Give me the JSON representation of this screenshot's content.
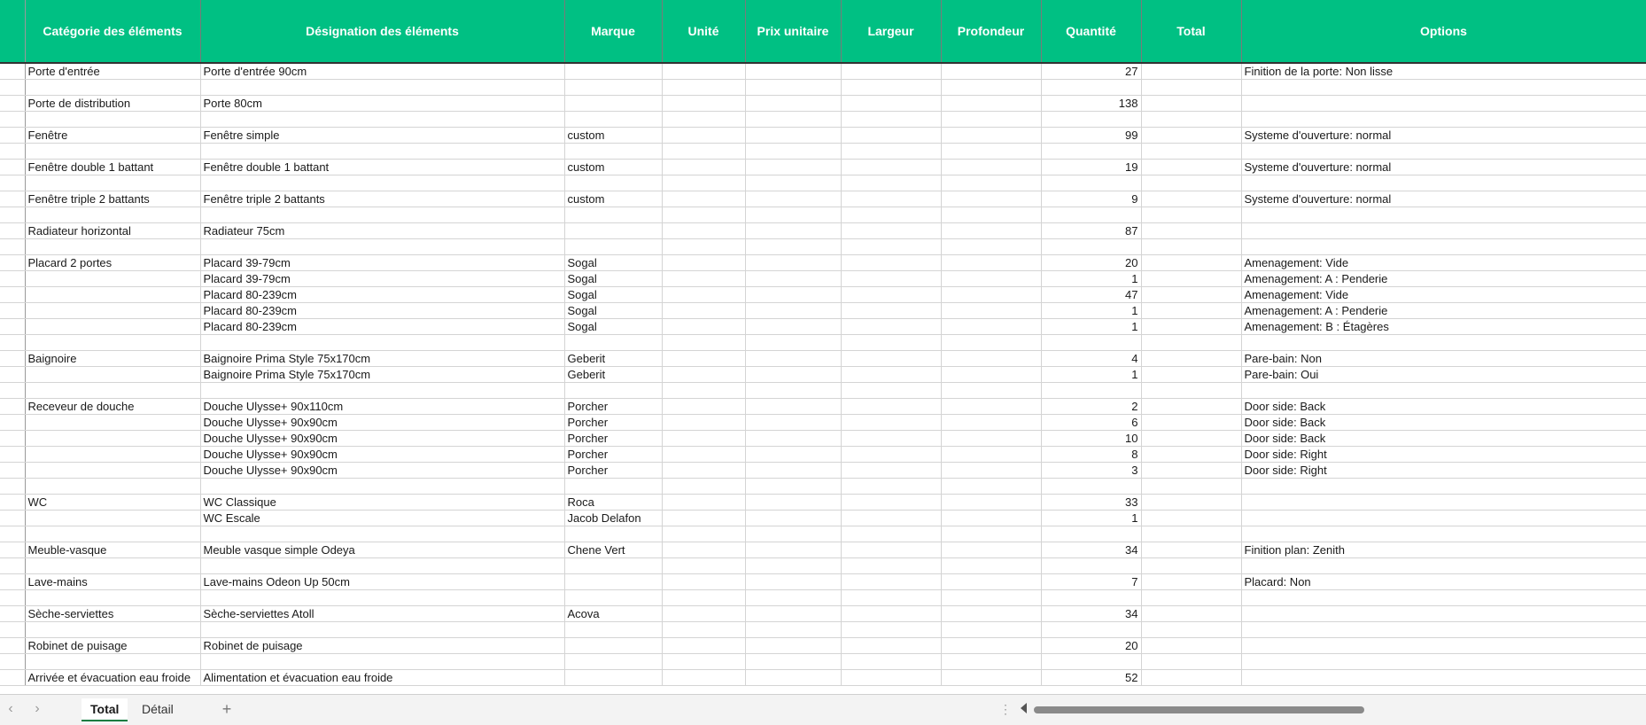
{
  "headers": [
    "Catégorie des éléments",
    "Désignation des éléments",
    "Marque",
    "Unité",
    "Prix unitaire",
    "Largeur",
    "Profondeur",
    "Quantité",
    "Total",
    "Options"
  ],
  "rows": [
    {
      "cat": "Porte d'entrée",
      "des": "Porte d'entrée 90cm",
      "marque": "",
      "qty": "27",
      "opt": "Finition de la porte: Non lisse"
    },
    {
      "spacer": true
    },
    {
      "cat": "Porte de distribution",
      "des": "Porte 80cm",
      "marque": "",
      "qty": "138",
      "opt": ""
    },
    {
      "spacer": true
    },
    {
      "cat": "Fenêtre",
      "des": "Fenêtre simple",
      "marque": "custom",
      "qty": "99",
      "opt": "Systeme d'ouverture: normal"
    },
    {
      "spacer": true
    },
    {
      "cat": "Fenêtre double 1 battant",
      "des": "Fenêtre double 1 battant",
      "marque": "custom",
      "qty": "19",
      "opt": "Systeme d'ouverture: normal"
    },
    {
      "spacer": true
    },
    {
      "cat": "Fenêtre triple 2 battants",
      "des": "Fenêtre triple 2 battants",
      "marque": "custom",
      "qty": "9",
      "opt": "Systeme d'ouverture: normal"
    },
    {
      "spacer": true
    },
    {
      "cat": "Radiateur horizontal",
      "des": "Radiateur 75cm",
      "marque": "",
      "qty": "87",
      "opt": ""
    },
    {
      "spacer": true
    },
    {
      "cat": "Placard 2 portes",
      "des": "Placard 39-79cm",
      "marque": "Sogal",
      "qty": "20",
      "opt": "Amenagement: Vide"
    },
    {
      "cat": "",
      "des": "Placard 39-79cm",
      "marque": "Sogal",
      "qty": "1",
      "opt": "Amenagement: A : Penderie"
    },
    {
      "cat": "",
      "des": "Placard 80-239cm",
      "marque": "Sogal",
      "qty": "47",
      "opt": "Amenagement: Vide"
    },
    {
      "cat": "",
      "des": "Placard 80-239cm",
      "marque": "Sogal",
      "qty": "1",
      "opt": "Amenagement: A : Penderie"
    },
    {
      "cat": "",
      "des": "Placard 80-239cm",
      "marque": "Sogal",
      "qty": "1",
      "opt": "Amenagement: B : Étagères"
    },
    {
      "spacer": true
    },
    {
      "cat": "Baignoire",
      "des": "Baignoire Prima Style 75x170cm",
      "marque": "Geberit",
      "qty": "4",
      "opt": "Pare-bain: Non"
    },
    {
      "cat": "",
      "des": "Baignoire Prima Style 75x170cm",
      "marque": "Geberit",
      "qty": "1",
      "opt": "Pare-bain: Oui"
    },
    {
      "spacer": true
    },
    {
      "cat": "Receveur de douche",
      "des": "Douche Ulysse+ 90x110cm",
      "marque": "Porcher",
      "qty": "2",
      "opt": "Door side: Back"
    },
    {
      "cat": "",
      "des": "Douche Ulysse+ 90x90cm",
      "marque": "Porcher",
      "qty": "6",
      "opt": "Door side: Back"
    },
    {
      "cat": "",
      "des": "Douche Ulysse+ 90x90cm",
      "marque": "Porcher",
      "qty": "10",
      "opt": "Door side: Back"
    },
    {
      "cat": "",
      "des": "Douche Ulysse+ 90x90cm",
      "marque": "Porcher",
      "qty": "8",
      "opt": "Door side: Right"
    },
    {
      "cat": "",
      "des": "Douche Ulysse+ 90x90cm",
      "marque": "Porcher",
      "qty": "3",
      "opt": "Door side: Right"
    },
    {
      "spacer": true
    },
    {
      "cat": "WC",
      "des": "WC Classique",
      "marque": "Roca",
      "qty": "33",
      "opt": ""
    },
    {
      "cat": "",
      "des": "WC Escale",
      "marque": "Jacob Delafon",
      "qty": "1",
      "opt": ""
    },
    {
      "spacer": true
    },
    {
      "cat": "Meuble-vasque",
      "des": "Meuble vasque simple Odeya",
      "marque": "Chene Vert",
      "qty": "34",
      "opt": "Finition plan: Zenith"
    },
    {
      "spacer": true
    },
    {
      "cat": "Lave-mains",
      "des": "Lave-mains Odeon Up 50cm",
      "marque": "",
      "qty": "7",
      "opt": "Placard: Non"
    },
    {
      "spacer": true
    },
    {
      "cat": "Sèche-serviettes",
      "des": "Sèche-serviettes Atoll",
      "marque": "Acova",
      "qty": "34",
      "opt": ""
    },
    {
      "spacer": true
    },
    {
      "cat": "Robinet de puisage",
      "des": "Robinet de puisage",
      "marque": "",
      "qty": "20",
      "opt": ""
    },
    {
      "spacer": true
    },
    {
      "cat": "Arrivée et évacuation eau froide",
      "des": "Alimentation et évacuation eau froide",
      "marque": "",
      "qty": "52",
      "opt": ""
    }
  ],
  "tabs": {
    "total": "Total",
    "detail": "Détail",
    "add": "+"
  },
  "nav": {
    "prev": "‹",
    "next": "›",
    "dots": "⋮"
  },
  "colors": {
    "header_bg": "#00c083",
    "header_text": "#ffffff",
    "active_tab_underline": "#107c41"
  }
}
